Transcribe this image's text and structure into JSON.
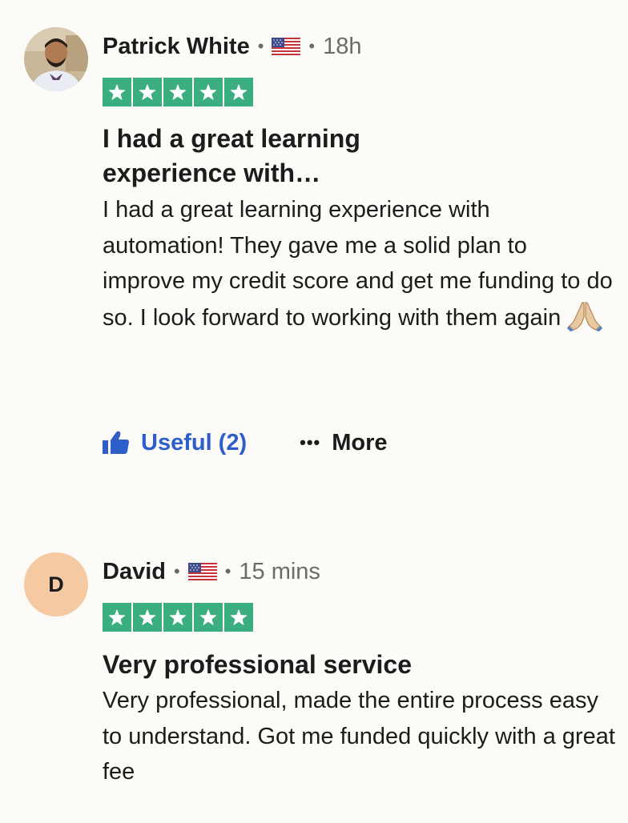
{
  "colors": {
    "background": "#fcfbf7",
    "star_green": "#3aae7f",
    "useful_blue": "#2d5ec9",
    "muted_text": "#6b6b6b",
    "initial_avatar_bg": "#f5c9a2"
  },
  "reviews": [
    {
      "author": "Patrick White",
      "country_flag_icon": "us-flag-icon",
      "time": "18h",
      "rating": 5,
      "title": "I had a great learning experience with…",
      "body": "I had a great learning experience with automation! They gave me a solid plan to improve my credit score and get me funding to do so. I look forward to working with them again",
      "body_emoji": "folded-hands-icon",
      "useful_label": "Useful (2)",
      "more_label": "More"
    },
    {
      "author": "David",
      "avatar_initial": "D",
      "country_flag_icon": "us-flag-icon",
      "time": "15 mins",
      "rating": 5,
      "title": "Very professional service",
      "body": "Very professional, made the entire process easy to understand. Got me funded quickly with a great fee"
    }
  ],
  "separator": "•"
}
